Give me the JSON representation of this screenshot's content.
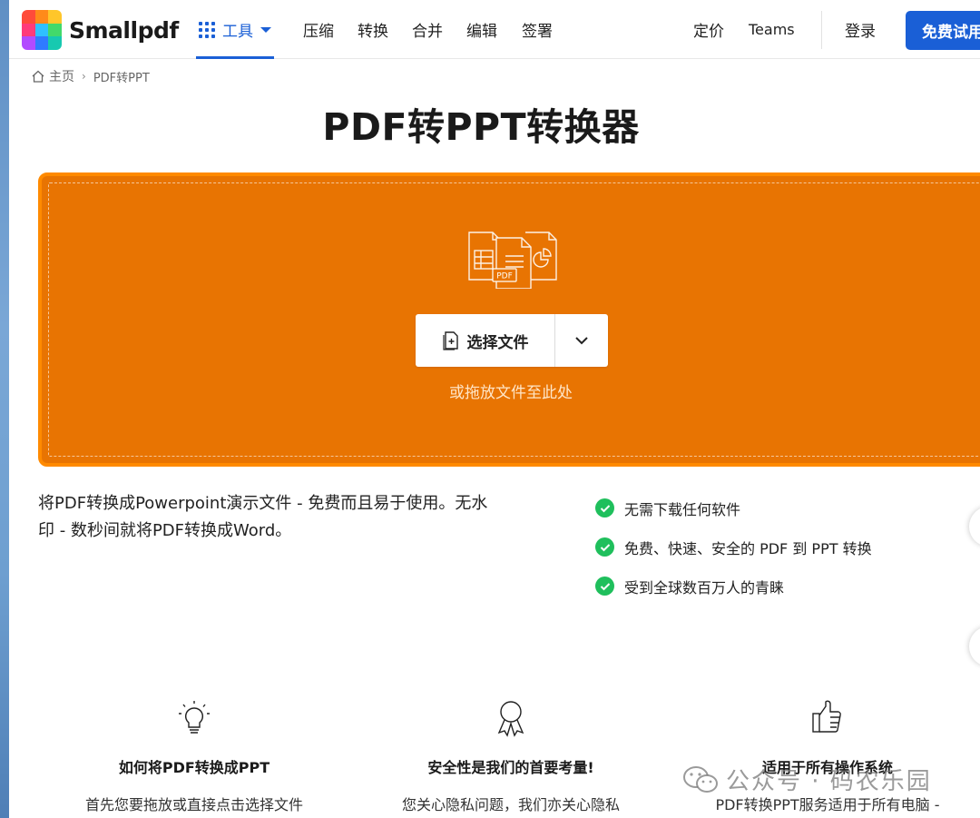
{
  "header": {
    "logo_text": "Smallpdf",
    "tools_label": "工具",
    "nav": [
      "压缩",
      "转换",
      "合并",
      "编辑",
      "签署"
    ],
    "pricing_label": "定价",
    "teams_label": "Teams",
    "login_label": "登录",
    "cta_label": "免费试用"
  },
  "breadcrumb": {
    "home": "主页",
    "current": "PDF转PPT"
  },
  "page_title": "PDF转PPT转换器",
  "dropzone": {
    "choose_label": "选择文件",
    "hint": "或拖放文件至此处",
    "pdf_badge": "PDF"
  },
  "description": "将PDF转换成Powerpoint演示文件 - 免费而且易于使用。无水印 - 数秒间就将PDF转换成Word。",
  "features": [
    "无需下载任何软件",
    "免费、快速、安全的 PDF 到 PPT 转换",
    "受到全球数百万人的青睐"
  ],
  "info": [
    {
      "title": "如何将PDF转换成PPT",
      "text": "首先您要拖放或直接点击选择文件"
    },
    {
      "title": "安全性是我们的首要考量!",
      "text": "您关心隐私问题，我们亦关心隐私"
    },
    {
      "title": "适用于所有操作系统",
      "text": "PDF转换PPT服务适用于所有电脑 -"
    }
  ],
  "watermark": "公众号 · 码农乐园",
  "colors": {
    "brand_blue": "#1a5fd6",
    "dropzone_orange": "#e87402",
    "check_green": "#1fbf5c"
  }
}
